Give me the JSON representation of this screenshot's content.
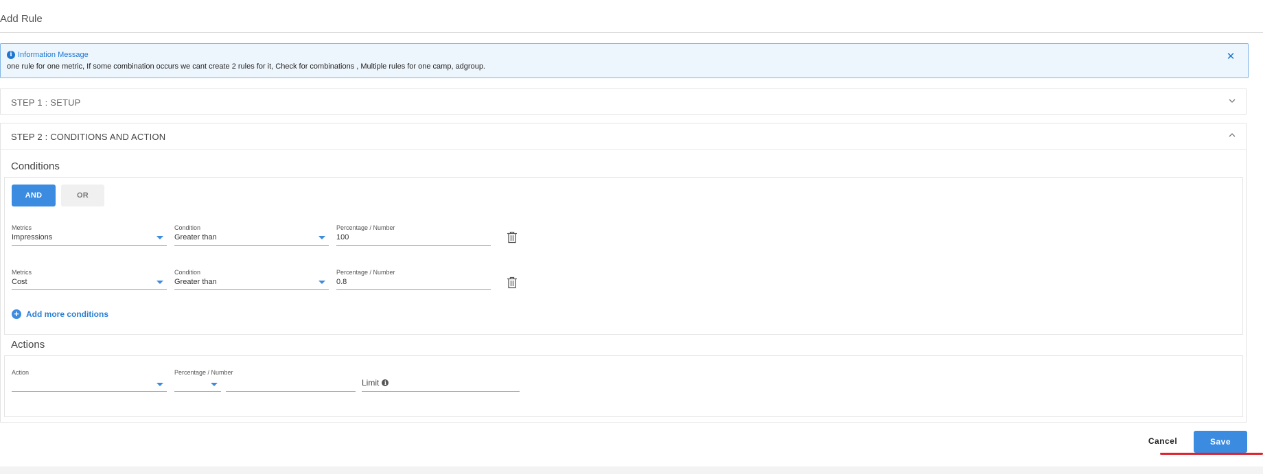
{
  "header": {
    "title": "Add Rule"
  },
  "info": {
    "title": "Information Message",
    "text": "one rule for one metric, If some combination occurs we cant create 2 rules for it, Check for combinations , Multiple rules for one camp, adgroup."
  },
  "steps": [
    {
      "title": "STEP 1 : SETUP",
      "expanded": false
    },
    {
      "title": "STEP 2 : CONDITIONS AND ACTION",
      "expanded": true
    }
  ],
  "conditions": {
    "title": "Conditions",
    "logic": {
      "and_label": "AND",
      "or_label": "OR",
      "selected": "AND"
    },
    "rows": [
      {
        "metric_label": "Metrics",
        "metric_value": "Impressions",
        "condition_label": "Condition",
        "condition_value": "Greater than",
        "number_label": "Percentage / Number",
        "number_value": "100"
      },
      {
        "metric_label": "Metrics",
        "metric_value": "Cost",
        "condition_label": "Condition",
        "condition_value": "Greater than",
        "number_label": "Percentage / Number",
        "number_value": "0.8"
      }
    ],
    "add_more_label": "Add more conditions"
  },
  "actions": {
    "title": "Actions",
    "action_label": "Action",
    "action_value": "",
    "number_label": "Percentage / Number",
    "limit_label": "Limit"
  },
  "footer": {
    "cancel_label": "Cancel",
    "save_label": "Save"
  },
  "colors": {
    "accent": "#3b8be0",
    "info_bg": "#eef6fd",
    "annotation": "#e0202a"
  }
}
